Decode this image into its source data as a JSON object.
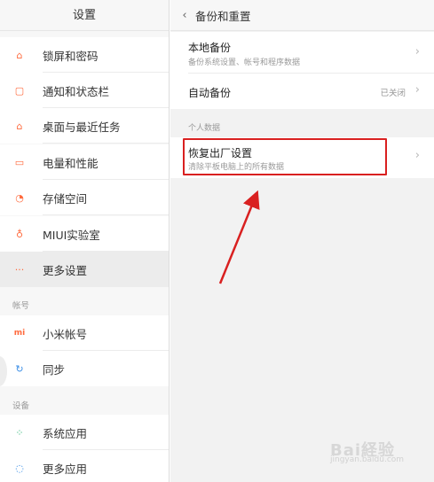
{
  "left": {
    "title": "设置",
    "items": [
      {
        "label": "锁屏和密码",
        "icon": "lock-icon",
        "glyph": "⌂"
      },
      {
        "label": "通知和状态栏",
        "icon": "notification-icon",
        "glyph": "▢"
      },
      {
        "label": "桌面与最近任务",
        "icon": "home-icon",
        "glyph": "⌂"
      },
      {
        "label": "电量和性能",
        "icon": "battery-icon",
        "glyph": "▭"
      },
      {
        "label": "存储空间",
        "icon": "storage-icon",
        "glyph": "◔"
      },
      {
        "label": "MIUI实验室",
        "icon": "lab-icon",
        "glyph": "♁"
      },
      {
        "label": "更多设置",
        "icon": "more-icon",
        "glyph": "···"
      }
    ],
    "section_account": "帐号",
    "account_items": [
      {
        "label": "小米帐号",
        "icon": "mi-icon",
        "glyph": "mi"
      },
      {
        "label": "同步",
        "icon": "sync-icon",
        "glyph": "↻"
      }
    ],
    "section_device": "设备",
    "device_items": [
      {
        "label": "系统应用",
        "icon": "apps-icon",
        "glyph": "⁘"
      },
      {
        "label": "更多应用",
        "icon": "more-apps-icon",
        "glyph": "◌"
      }
    ]
  },
  "right": {
    "back_glyph": "‹",
    "title": "备份和重置",
    "local_backup": {
      "title": "本地备份",
      "subtitle": "备份系统设置、帐号和程序数据"
    },
    "auto_backup": {
      "title": "自动备份",
      "value": "已关闭"
    },
    "section_personal": "个人数据",
    "factory_reset": {
      "title": "恢复出厂设置",
      "subtitle": "清除平板电脑上的所有数据"
    },
    "chevron": "›"
  },
  "colors": {
    "accent": "#ff6a3d",
    "highlight": "#d92020"
  },
  "watermark": {
    "main": "Bai経验",
    "sub": "jingyan.baidu.com"
  }
}
